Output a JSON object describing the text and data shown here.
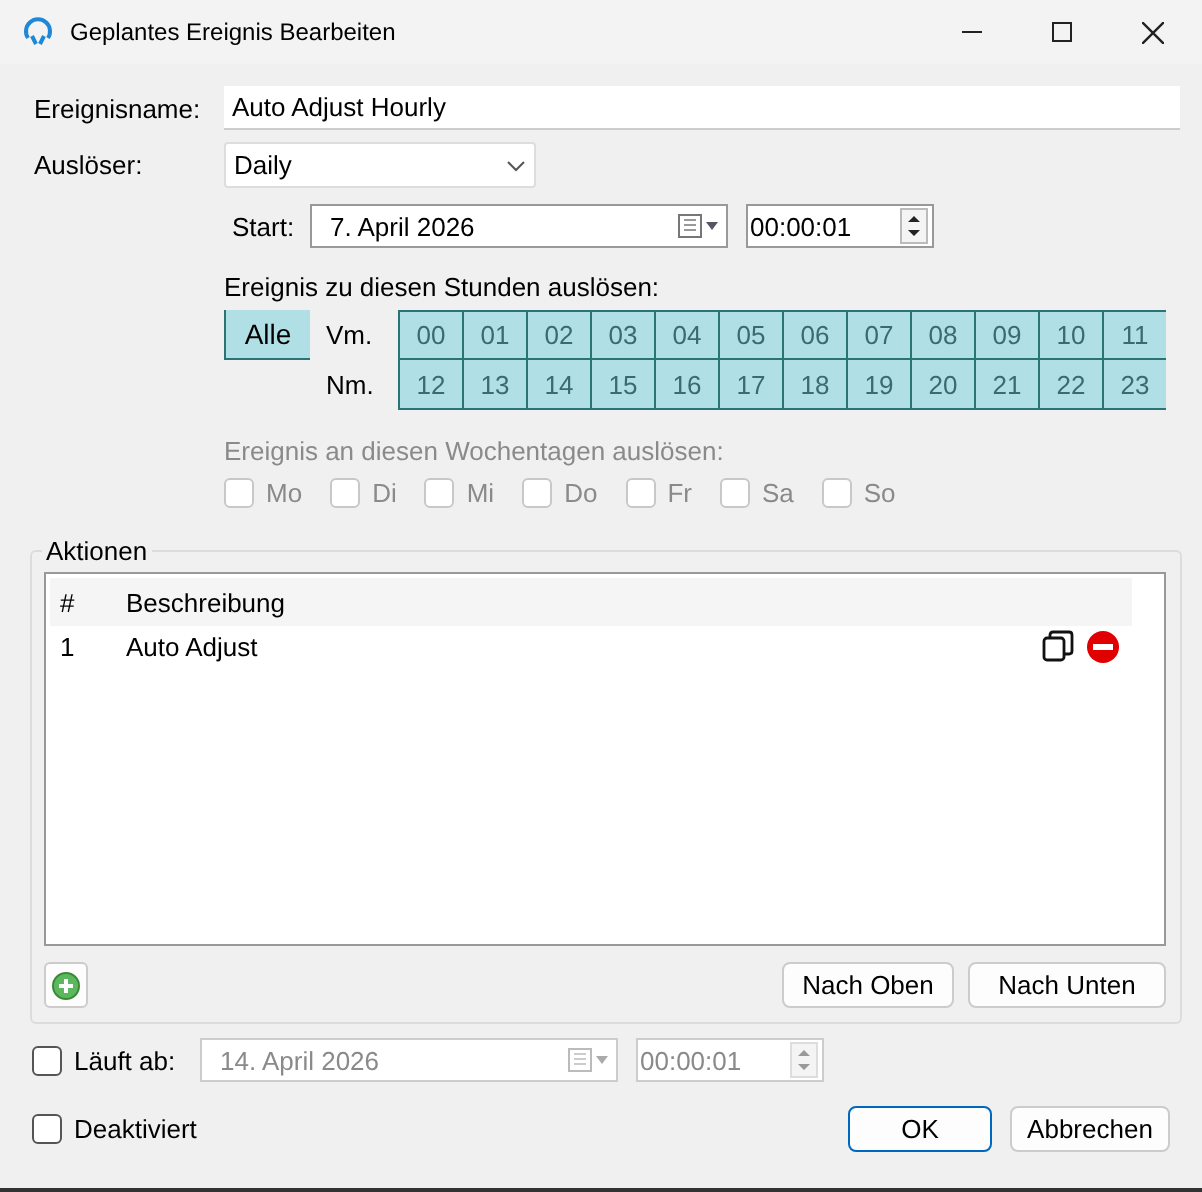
{
  "window": {
    "title": "Geplantes Ereignis Bearbeiten"
  },
  "name_field": {
    "label": "Ereignisname:",
    "value": "Auto Adjust Hourly"
  },
  "trigger": {
    "label": "Auslöser:",
    "value": "Daily"
  },
  "start": {
    "label": "Start:",
    "date": "7. April 2026",
    "time": "00:00:01"
  },
  "hours": {
    "heading": "Ereignis zu diesen Stunden auslösen:",
    "all": {
      "label": "Alle",
      "selected": true
    },
    "rows": [
      {
        "label": "Vm.",
        "hours": [
          {
            "label": "00",
            "selected": true
          },
          {
            "label": "01",
            "selected": true
          },
          {
            "label": "02",
            "selected": true
          },
          {
            "label": "03",
            "selected": true
          },
          {
            "label": "04",
            "selected": true
          },
          {
            "label": "05",
            "selected": true
          },
          {
            "label": "06",
            "selected": true
          },
          {
            "label": "07",
            "selected": true
          },
          {
            "label": "08",
            "selected": true
          },
          {
            "label": "09",
            "selected": true
          },
          {
            "label": "10",
            "selected": true
          },
          {
            "label": "11",
            "selected": true
          }
        ]
      },
      {
        "label": "Nm.",
        "hours": [
          {
            "label": "12",
            "selected": true
          },
          {
            "label": "13",
            "selected": true
          },
          {
            "label": "14",
            "selected": true
          },
          {
            "label": "15",
            "selected": true
          },
          {
            "label": "16",
            "selected": true
          },
          {
            "label": "17",
            "selected": true
          },
          {
            "label": "18",
            "selected": true
          },
          {
            "label": "19",
            "selected": true
          },
          {
            "label": "20",
            "selected": true
          },
          {
            "label": "21",
            "selected": true
          },
          {
            "label": "22",
            "selected": true
          },
          {
            "label": "23",
            "selected": true
          }
        ]
      }
    ]
  },
  "weekdays": {
    "heading": "Ereignis an diesen Wochentagen auslösen:",
    "disabled": true,
    "days": [
      {
        "label": "Mo",
        "checked": false
      },
      {
        "label": "Di",
        "checked": false
      },
      {
        "label": "Mi",
        "checked": false
      },
      {
        "label": "Do",
        "checked": false
      },
      {
        "label": "Fr",
        "checked": false
      },
      {
        "label": "Sa",
        "checked": false
      },
      {
        "label": "So",
        "checked": false
      }
    ]
  },
  "actions": {
    "title": "Aktionen",
    "columns": [
      "#",
      "Beschreibung"
    ],
    "rows": [
      {
        "number": "1",
        "description": "Auto Adjust"
      }
    ],
    "buttons": [
      "Nach Oben",
      "Nach Unten"
    ]
  },
  "expires": {
    "label": "Läuft ab:",
    "checked": false,
    "date": "14. April 2026",
    "time": "00:00:01"
  },
  "deactivated": {
    "label": "Deaktiviert",
    "checked": false
  },
  "buttons": [
    {
      "label": "OK",
      "kind": "default"
    },
    {
      "label": "Abbrechen",
      "kind": "normal"
    }
  ]
}
